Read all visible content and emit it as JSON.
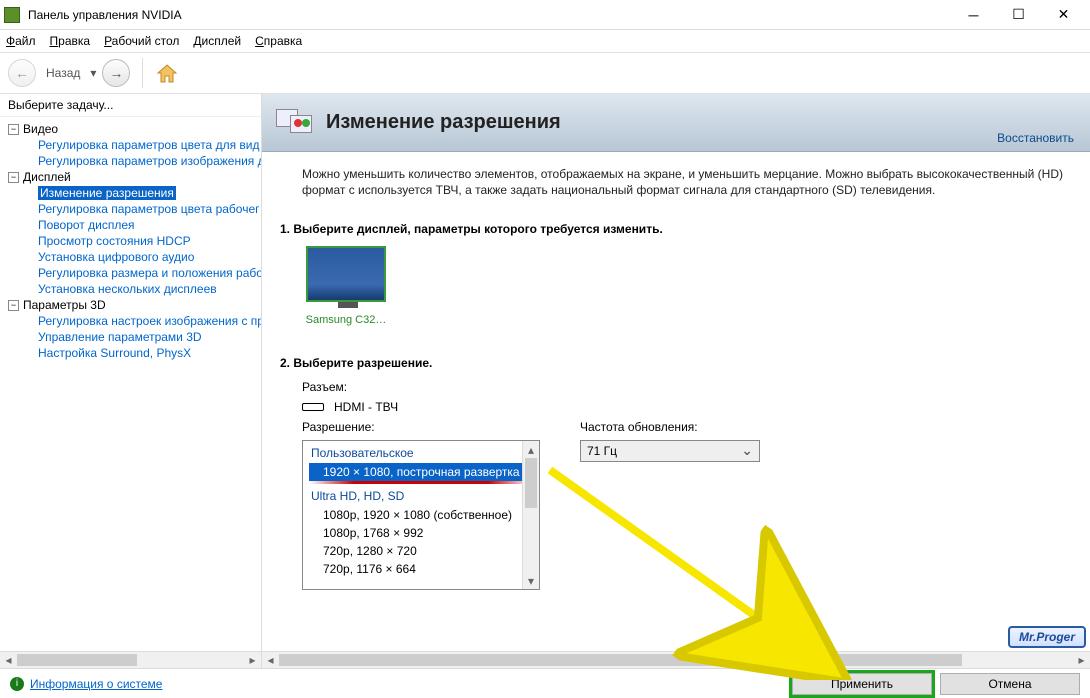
{
  "window": {
    "title": "Панель управления NVIDIA"
  },
  "menu": {
    "file": "Файл",
    "edit": "Правка",
    "desktop": "Рабочий стол",
    "display": "Дисплей",
    "help": "Справка"
  },
  "toolbar": {
    "back": "Назад"
  },
  "sidebar": {
    "title": "Выберите задачу...",
    "groups": [
      {
        "label": "Видео",
        "items": [
          "Регулировка параметров цвета для вид",
          "Регулировка параметров изображения д"
        ]
      },
      {
        "label": "Дисплей",
        "items": [
          "Изменение разрешения",
          "Регулировка параметров цвета рабочег",
          "Поворот дисплея",
          "Просмотр состояния HDCP",
          "Установка цифрового аудио",
          "Регулировка размера и положения рабо",
          "Установка нескольких дисплеев"
        ],
        "selected": 0
      },
      {
        "label": "Параметры 3D",
        "items": [
          "Регулировка настроек изображения с пр",
          "Управление параметрами 3D",
          "Настройка Surround, PhysX"
        ]
      }
    ]
  },
  "page": {
    "title": "Изменение разрешения",
    "restore": "Восстановить",
    "desc": "Можно уменьшить количество элементов, отображаемых на экране, и уменьшить мерцание. Можно выбрать высококачественный (HD) формат с используется ТВЧ, а также задать национальный формат сигнала для стандартного (SD) телевидения.",
    "step1": "1. Выберите дисплей, параметры которого требуется изменить.",
    "monitor": "Samsung C32…",
    "step2": "2. Выберите разрешение.",
    "connector_label": "Разъем:",
    "connector_value": "HDMI - ТВЧ",
    "resolution_label": "Разрешение:",
    "refresh_label": "Частота обновления:",
    "refresh_value": "71 Гц",
    "res_group1": "Пользовательское",
    "res_selected": "1920 × 1080, построчная развертка",
    "res_group2": "Ultra HD, HD, SD",
    "res_items": [
      "1080p, 1920 × 1080 (собственное)",
      "1080p, 1768 × 992",
      "720p, 1280 × 720",
      "720p, 1176 × 664"
    ]
  },
  "footer": {
    "info": "Информация о системе",
    "apply": "Применить",
    "cancel": "Отмена"
  },
  "watermark": "Mr.Proger"
}
